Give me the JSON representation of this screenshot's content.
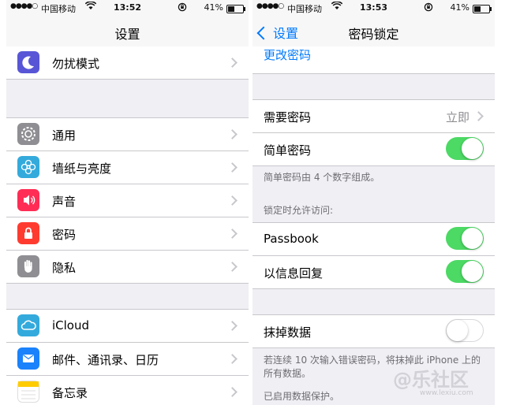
{
  "left": {
    "status": {
      "signal": "●●●●○",
      "carrier": "中国移动",
      "time": "13:52",
      "battery": "41%",
      "battery_level": 0.41
    },
    "nav": {
      "title": "设置"
    },
    "rows_top": [
      {
        "label": "勿扰模式",
        "icon": "moon-icon",
        "color": "#5856d6"
      }
    ],
    "rows_general": [
      {
        "label": "通用",
        "icon": "gear-icon",
        "color": "#8e8e93"
      },
      {
        "label": "墙纸与亮度",
        "icon": "flower-icon",
        "color": "#34aadc"
      },
      {
        "label": "声音",
        "icon": "speaker-icon",
        "color": "#ff2d55"
      },
      {
        "label": "密码",
        "icon": "lock-icon",
        "color": "#ff3b30"
      },
      {
        "label": "隐私",
        "icon": "hand-icon",
        "color": "#8e8e93"
      }
    ],
    "rows_apps": [
      {
        "label": "iCloud",
        "icon": "cloud-icon",
        "color": "#34aadc"
      },
      {
        "label": "邮件、通讯录、日历",
        "icon": "mail-icon",
        "color": "#1a82fb"
      },
      {
        "label": "备忘录",
        "icon": "notes-icon",
        "color": "#ffcc00"
      }
    ]
  },
  "right": {
    "status": {
      "signal": "●●●●○",
      "carrier": "中国移动",
      "time": "13:53",
      "battery": "41%",
      "battery_level": 0.41
    },
    "nav": {
      "back_label": "设置",
      "title": "密码锁定"
    },
    "change_password": "更改密码",
    "require_password": {
      "label": "需要密码",
      "value": "立即"
    },
    "simple_password": {
      "label": "简单密码",
      "on": true
    },
    "simple_note": "简单密码由 4 个数字组成。",
    "allow_header": "锁定时允许访问:",
    "passbook": {
      "label": "Passbook",
      "on": true
    },
    "reply_message": {
      "label": "以信息回复",
      "on": true
    },
    "erase_data": {
      "label": "抹掉数据",
      "on": false
    },
    "erase_note": "若连续 10 次输入错误密码，将抹掉此 iPhone 上的所有数据。",
    "protection_note": "已启用数据保护。"
  },
  "watermark": {
    "text": "@乐社区",
    "sub": "www.lexiu.com"
  }
}
